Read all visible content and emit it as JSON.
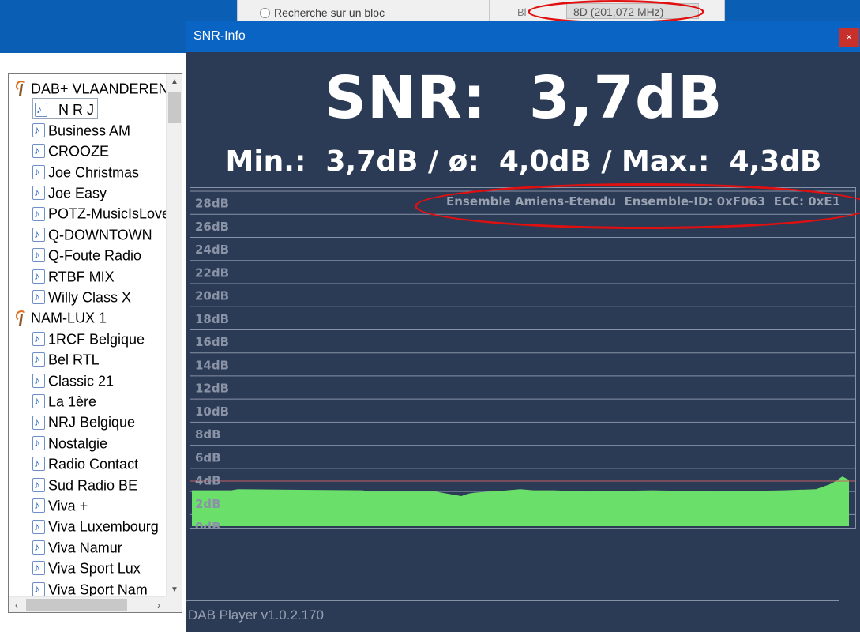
{
  "background_dialog": {
    "radio_label": "Recherche sur un bloc",
    "field_label": "Bl",
    "field_value": "8D (201,072 MHz)"
  },
  "station_tree": {
    "items": [
      {
        "type": "ensemble",
        "label": "DAB+ VLAANDEREN"
      },
      {
        "type": "station",
        "label": "N R J",
        "selected": true
      },
      {
        "type": "station",
        "label": "Business AM"
      },
      {
        "type": "station",
        "label": "CROOZE"
      },
      {
        "type": "station",
        "label": "Joe Christmas"
      },
      {
        "type": "station",
        "label": "Joe Easy"
      },
      {
        "type": "station",
        "label": "POTZ-MusicIsLove"
      },
      {
        "type": "station",
        "label": "Q-DOWNTOWN"
      },
      {
        "type": "station",
        "label": "Q-Foute Radio"
      },
      {
        "type": "station",
        "label": "RTBF MIX"
      },
      {
        "type": "station",
        "label": "Willy Class X"
      },
      {
        "type": "ensemble",
        "label": "NAM-LUX 1"
      },
      {
        "type": "station",
        "label": "1RCF Belgique"
      },
      {
        "type": "station",
        "label": "Bel RTL"
      },
      {
        "type": "station",
        "label": "Classic 21"
      },
      {
        "type": "station",
        "label": "La 1ère"
      },
      {
        "type": "station",
        "label": "NRJ Belgique"
      },
      {
        "type": "station",
        "label": "Nostalgie"
      },
      {
        "type": "station",
        "label": "Radio Contact"
      },
      {
        "type": "station",
        "label": "Sud Radio BE"
      },
      {
        "type": "station",
        "label": "Viva +"
      },
      {
        "type": "station",
        "label": "Viva Luxembourg"
      },
      {
        "type": "station",
        "label": "Viva Namur"
      },
      {
        "type": "station",
        "label": "Viva Sport Lux"
      },
      {
        "type": "station",
        "label": "Viva Sport Nam"
      }
    ]
  },
  "snr_window": {
    "title": "SNR-Info",
    "close_label": "×",
    "snr_text": "SNR:  3,7dB",
    "stats_text": "Min.:  3,7dB / ø:  4,0dB / Max.:  4,3dB",
    "ensemble_text": "Ensemble Amiens-Etendu  Ensemble-ID: 0xF063  ECC: 0xE1",
    "version": "DAB Player v1.0.2.170"
  },
  "colors": {
    "window_bg": "#2b3a55",
    "titlebar": "#0a64c4",
    "signal_fill": "#6ae06a",
    "grid_line": "#8892a6",
    "axis_label": "#8a93a6",
    "highlight_circle": "#e01010",
    "close_button": "#c8302c"
  },
  "chart_data": {
    "type": "area",
    "ylabel": "",
    "xlabel": "",
    "ylim": [
      0,
      29
    ],
    "y_ticks": [
      "0dB",
      "2dB",
      "4dB",
      "6dB",
      "8dB",
      "10dB",
      "12dB",
      "14dB",
      "16dB",
      "18dB",
      "20dB",
      "22dB",
      "24dB",
      "26dB",
      "28dB"
    ],
    "y_tick_values": [
      0,
      2,
      4,
      6,
      8,
      10,
      12,
      14,
      16,
      18,
      20,
      22,
      24,
      26,
      28
    ],
    "grid": true,
    "threshold_line": 3.9,
    "x": [
      0,
      0.06,
      0.07,
      0.26,
      0.27,
      0.37,
      0.38,
      0.41,
      0.42,
      0.43,
      0.48,
      0.5,
      0.52,
      0.55,
      0.6,
      0.7,
      0.8,
      0.9,
      0.95,
      0.96,
      0.97,
      0.98,
      0.985,
      0.99,
      1.0
    ],
    "series": [
      {
        "values": [
          3.1,
          3.1,
          3.2,
          3.1,
          3.0,
          3.0,
          2.9,
          2.6,
          2.8,
          2.9,
          3.1,
          3.2,
          3.1,
          3.1,
          3.0,
          3.1,
          3.0,
          3.1,
          3.2,
          3.4,
          3.6,
          3.9,
          4.1,
          4.3,
          4.0
        ]
      }
    ]
  }
}
